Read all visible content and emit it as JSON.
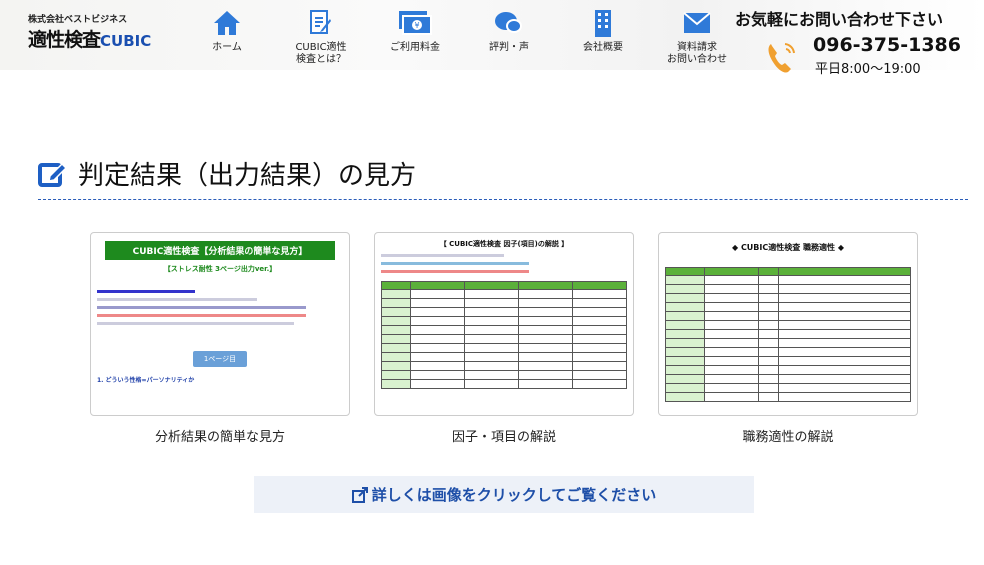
{
  "header": {
    "logo_sub": "株式会社ベストビジネス",
    "logo_main": "適性検査",
    "logo_brand": "CUBIC",
    "nav": [
      {
        "label": "ホーム",
        "icon": "home-icon"
      },
      {
        "label": "CUBIC適性\n検査とは？",
        "icon": "document-pen-icon"
      },
      {
        "label": "ご利用料金",
        "icon": "money-icon"
      },
      {
        "label": "評判・声",
        "icon": "chat-bubble-icon"
      },
      {
        "label": "会社概要",
        "icon": "building-icon"
      },
      {
        "label": "資料請求\nお問い合わせ",
        "icon": "mail-icon"
      }
    ],
    "contact_message": "お気軽にお問い合わせ下さい",
    "phone": "096-375-1386",
    "hours": "平日8:00〜19:00"
  },
  "section": {
    "title": "判定結果（出力結果）の見方"
  },
  "cards": [
    {
      "caption": "分析結果の簡単な見方",
      "doc_title": "CUBIC適性検査【分析結果の簡単な見方】",
      "doc_subtitle": "【ストレス耐性 3ページ出力ver.】",
      "doc_page_button": "1ページ目",
      "doc_heading": "1. どういう性格=パーソナリティか"
    },
    {
      "caption": "因子・項目の解説",
      "doc_title": "【 CUBIC適性検査 因子(項目)の解説 】"
    },
    {
      "caption": "職務適性の解説",
      "doc_title": "◆ CUBIC適性検査 職務適性 ◆"
    }
  ],
  "cta": {
    "label": "詳しくは画像をクリックしてご覧ください"
  },
  "colors": {
    "accent": "#1e4fa8",
    "green": "#1e8a1e"
  }
}
